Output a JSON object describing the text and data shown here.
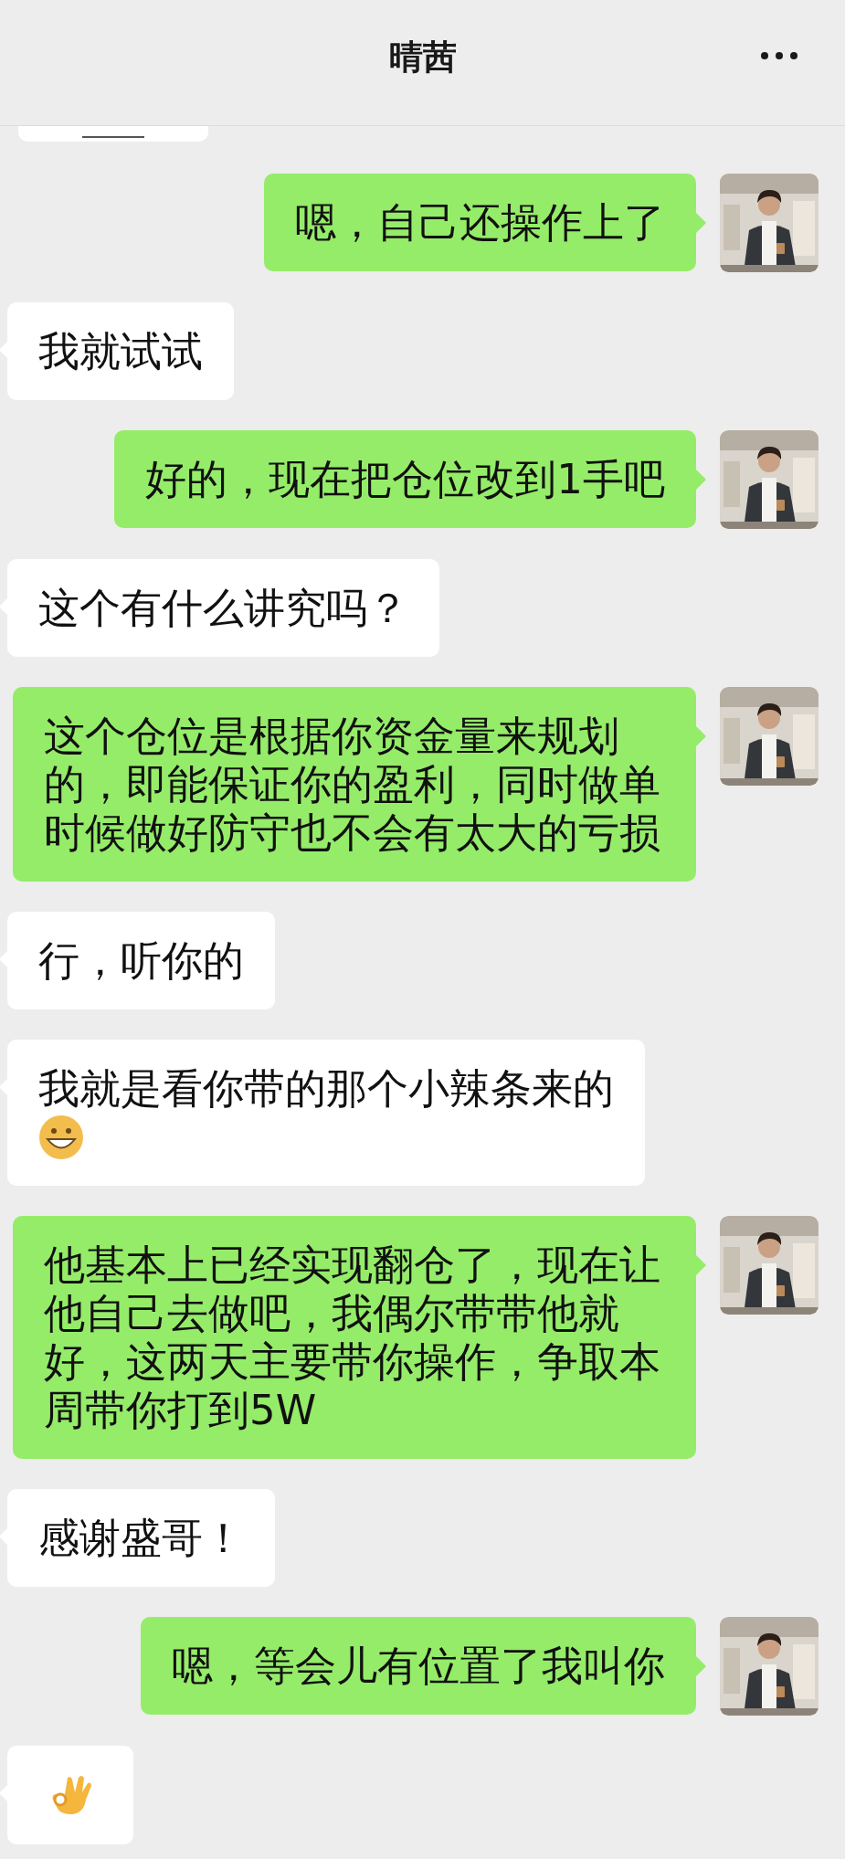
{
  "header": {
    "title": "晴茜"
  },
  "messages": [
    {
      "outgoing": false,
      "kind": "cut"
    },
    {
      "outgoing": true,
      "kind": "text",
      "text": "嗯，自己还操作上了"
    },
    {
      "outgoing": false,
      "kind": "text",
      "text": "我就试试"
    },
    {
      "outgoing": true,
      "kind": "text",
      "text": "好的，现在把仓位改到1手吧"
    },
    {
      "outgoing": false,
      "kind": "text",
      "text": "这个有什么讲究吗？"
    },
    {
      "outgoing": true,
      "kind": "text",
      "text": "这个仓位是根据你资金量来规划的，即能保证你的盈利，同时做单时候做好防守也不会有太大的亏损"
    },
    {
      "outgoing": false,
      "kind": "text",
      "text": "行，听你的"
    },
    {
      "outgoing": false,
      "kind": "text",
      "text": "我就是看你带的那个小辣条来的",
      "grin": true
    },
    {
      "outgoing": true,
      "kind": "text",
      "text": "他基本上已经实现翻仓了，现在让他自己去做吧，我偶尔带带他就好，这两天主要带你操作，争取本周带你打到5W"
    },
    {
      "outgoing": false,
      "kind": "text",
      "text": "感谢盛哥！"
    },
    {
      "outgoing": true,
      "kind": "text",
      "text": "嗯，等会儿有位置了我叫你"
    },
    {
      "outgoing": false,
      "kind": "okhand"
    }
  ]
}
